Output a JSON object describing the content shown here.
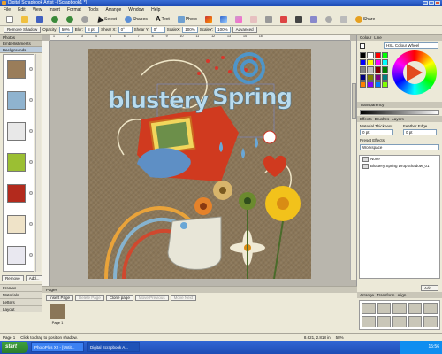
{
  "window": {
    "title": "Digital Scrapbook Artist - [Scrapbook1 *]"
  },
  "menu": [
    "File",
    "Edit",
    "View",
    "Insert",
    "Format",
    "Tools",
    "Arrange",
    "Window",
    "Help"
  ],
  "toolbar": {
    "select": "Select",
    "shapes": "Shapes",
    "text": "Text",
    "photo": "Photo",
    "share": "Share"
  },
  "context_bar": {
    "remove_shadow": "Remove Shadow",
    "opacity_label": "Opacity:",
    "opacity": "50%",
    "blur_label": "Blur:",
    "blur": "8 pt",
    "shear_x_label": "Shear X:",
    "shear_x": "0°",
    "shear_y_label": "Shear Y:",
    "shear_y": "0°",
    "scale_x_label": "ScaleX:",
    "scale_x": "100%",
    "scale_y_label": "ScaleY:",
    "scale_y": "100%",
    "advanced": "Advanced"
  },
  "left_panel": {
    "head1": "Photos",
    "head2": "Embellishments",
    "head3": "Backgrounds",
    "remove_btn": "Remove",
    "add_btn": "Add...",
    "sections": [
      "Frames",
      "Materials",
      "Letters",
      "Layout"
    ],
    "swatch_colors": [
      "#9a7d5a",
      "#8fb3cf",
      "#e8e8e8",
      "#9bbf33",
      "#b32a1d",
      "#efe3c8",
      "#e9e8f0"
    ]
  },
  "canvas": {
    "title_word1": "blustery",
    "title_word2": "Spring"
  },
  "pages_bar": {
    "head": "Pages",
    "insert_page": "Insert Page",
    "delete_page": "Delete Page",
    "clone_page": "Clone page",
    "move_previous": "Move Previous",
    "move_next": "Move Next",
    "thumb_caption": "Page 1"
  },
  "right_panel": {
    "tab_colour": "Colour",
    "tab_line": "Line",
    "model": "HSL Colour Wheel",
    "transparency": "Transparency",
    "tab_effects": "Effects",
    "tab_brushes": "Brushes",
    "tab_layers": "Layers",
    "material_thickness": "Material Thickness",
    "feather_edge": "Feather Edge",
    "mt_value": "0 pt",
    "fe_value": "0 pt",
    "preset_effects": "Preset Effects",
    "workspace": "Workspace",
    "effect_none": "None",
    "effect_item": "Blustery Spring Drop Shadow_01",
    "tab_arrange": "Arrange",
    "tab_transform": "Transform",
    "tab_align": "Align",
    "palette": [
      "#000000",
      "#ffffff",
      "#ff0000",
      "#00ff00",
      "#0000ff",
      "#ffff00",
      "#ff00ff",
      "#00ffff",
      "#808080",
      "#c0c0c0",
      "#800000",
      "#008000",
      "#000080",
      "#808000",
      "#800080",
      "#008080",
      "#ff8000",
      "#8000ff",
      "#0080ff",
      "#80ff00"
    ]
  },
  "status": {
    "page": "Page 1",
    "hint": "Click to drag to position shadow.",
    "coords": "8.621, 2.818 in",
    "zoom": "58%"
  },
  "taskbar": {
    "start": "start",
    "tasks": [
      "PhotoPlus X2 - [Untit...",
      "Digital Scrapbook A..."
    ],
    "clock": "15:56"
  }
}
